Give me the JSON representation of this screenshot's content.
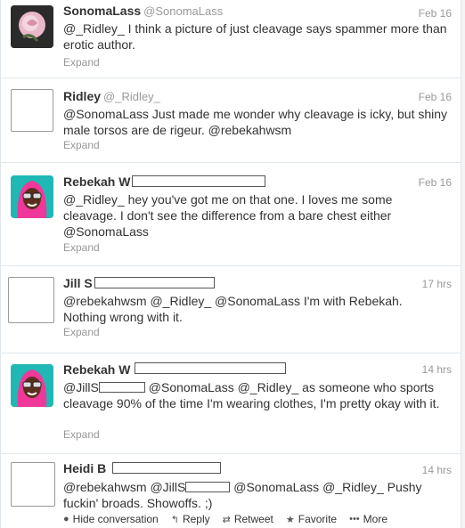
{
  "tweets": [
    {
      "name": "SonomaLass",
      "handle": "@SonomaLass",
      "time": "Feb 16",
      "text": "@_Ridley_ I think a picture of just cleavage says spammer more than erotic author.",
      "expand": "Expand",
      "avatar": "rose-photo"
    },
    {
      "name": "Ridley",
      "handle": "@_Ridley_",
      "time": "Feb 16",
      "text": "@SonomaLass Just made me wonder why cleavage is icky, but shiny male torsos are de rigeur. @rebekahwsm",
      "expand": "Expand",
      "avatar": "blank"
    },
    {
      "name": "Rebekah W",
      "time": "Feb 16",
      "text": "@_Ridley_ hey you've got me on that one. I loves me some cleavage. I don't see the difference from a bare chest either @SonomaLass",
      "expand": "Expand",
      "avatar": "cartoon-pink-hair"
    },
    {
      "name": "Jill S",
      "time": "17 hrs",
      "text": "@rebekahwsm @_Ridley_ @SonomaLass I'm with Rebekah. Nothing wrong with it.",
      "expand": "Expand",
      "avatar": "blank"
    },
    {
      "name": "Rebekah W",
      "time": "14 hrs",
      "text_a": "@JillS",
      "text_b": " @SonomaLass @_Ridley_ as someone who sports cleavage 90% of the time I'm wearing clothes, I'm pretty okay with it.",
      "expand": "Expand",
      "avatar": "cartoon-pink-hair"
    },
    {
      "name": "Heidi B",
      "time": "14 hrs",
      "text_a": "@rebekahwsm @JillS",
      "text_b": " @SonomaLass @_Ridley_ Pushy fuckin' broads. Showoffs. ;)",
      "avatar": "blank",
      "actions": {
        "hide": "Hide conversation",
        "reply": "Reply",
        "retweet": "Retweet",
        "favorite": "Favorite",
        "more": "More"
      }
    }
  ],
  "colors": {
    "link": "#333333",
    "muted": "#999999",
    "border": "#e1e8ed"
  }
}
